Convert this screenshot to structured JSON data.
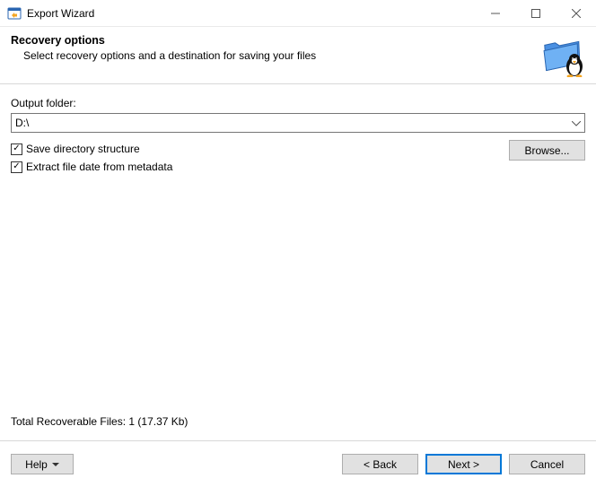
{
  "window": {
    "title": "Export Wizard"
  },
  "header": {
    "heading": "Recovery options",
    "subheading": "Select recovery options and a destination for saving your files"
  },
  "main": {
    "output_folder_label": "Output folder:",
    "output_folder_value": "D:\\",
    "save_dir_structure_label": "Save directory structure",
    "save_dir_structure_checked": true,
    "extract_date_label": "Extract file date from metadata",
    "extract_date_checked": true,
    "browse_label": "Browse...",
    "stats": "Total Recoverable Files: 1 (17.37 Kb)"
  },
  "footer": {
    "help_label": "Help",
    "back_label": "< Back",
    "next_label": "Next >",
    "cancel_label": "Cancel"
  }
}
